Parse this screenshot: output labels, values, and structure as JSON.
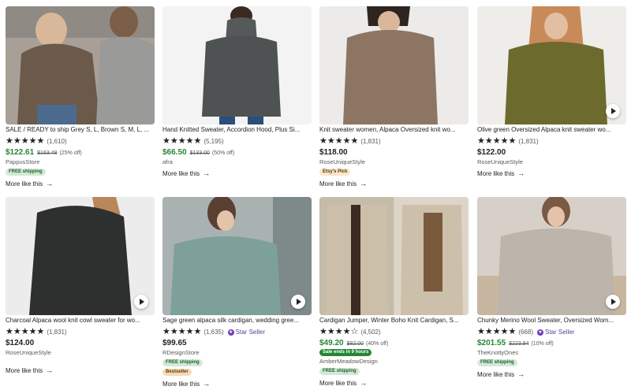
{
  "listings": [
    {
      "title": "SALE / READY to ship Grey S, L, Brown S, M, L, ...",
      "stars": "★★★★★",
      "rating_count": "(1,610)",
      "price": "$122.61",
      "original_price": "$163.48",
      "discount": "(25% off)",
      "shop": "PappusStore",
      "tags": [
        "FREE shipping"
      ],
      "more": "More like this",
      "colors": {
        "bg": "#c9c2b8",
        "fg": "#6b5a4a"
      }
    },
    {
      "title": "Hand Knitted Sweater, Accordion Hood, Plus Si...",
      "stars": "★★★★★",
      "rating_count": "(5,195)",
      "price": "$66.50",
      "original_price": "$133.00",
      "discount": "(50% off)",
      "shop": "afra",
      "tags": [],
      "more": "More like this",
      "colors": {
        "bg": "#f2f2f2",
        "fg": "#4f5253"
      }
    },
    {
      "title": "Knit sweater women, Alpaca Oversized knit wo...",
      "stars": "★★★★★",
      "rating_count": "(1,831)",
      "price": "$118.00",
      "original_price": "",
      "discount": "",
      "shop": "RoseUniqueStyle",
      "tags": [
        "Etsy's Pick"
      ],
      "more": "More like this",
      "colors": {
        "bg": "#e9e7e5",
        "fg": "#8c7663"
      }
    },
    {
      "title": "Olive green Oversized Alpaca knit sweater wo...",
      "stars": "★★★★★",
      "rating_count": "(1,831)",
      "price": "$122.00",
      "original_price": "",
      "discount": "",
      "shop": "RoseUniqueStyle",
      "tags": [],
      "more": "More like this",
      "colors": {
        "bg": "#efede9",
        "fg": "#6d6a2e"
      }
    },
    {
      "title": "Charcoal Alpaca wool knit cowl sweater for wo...",
      "stars": "★★★★★",
      "rating_count": "(1,831)",
      "price": "$124.00",
      "original_price": "",
      "discount": "",
      "shop": "RoseUniqueStyle",
      "tags": [],
      "more": "More like this",
      "colors": {
        "bg": "#ebebeb",
        "fg": "#2e3030"
      }
    },
    {
      "title": "Sage green alpaca silk cardigan, wedding gree...",
      "stars": "★★★★★",
      "rating_count": "(1,635)",
      "star_seller": "Star Seller",
      "price": "$99.65",
      "original_price": "",
      "discount": "",
      "shop": "RDesignStore",
      "tags": [
        "FREE shipping",
        "Bestseller"
      ],
      "more": "More like this",
      "colors": {
        "bg": "#aeb7b5",
        "fg": "#7da09a"
      }
    },
    {
      "title": "Cardigan Jumper, Winter Boho Knit Cardigan, S...",
      "stars": "★★★★☆",
      "rating_count": "(4,502)",
      "price": "$49.20",
      "original_price": "$82.00",
      "discount": "(40% off)",
      "shop": "AmberMeadowDesign",
      "tags": [
        "Sale ends in 9 hours",
        "FREE shipping"
      ],
      "more": "More like this",
      "colors": {
        "bg": "#d8d0c4",
        "fg": "#cbbfa9"
      }
    },
    {
      "title": "Chunky Merino Wool Sweater, Oversized Wom...",
      "stars": "★★★★★",
      "rating_count": "(668)",
      "star_seller": "Star Seller",
      "price": "$201.55",
      "original_price": "$223.94",
      "discount": "(10% off)",
      "shop": "TheKnottyOnes",
      "tags": [
        "FREE shipping"
      ],
      "more": "More like this",
      "colors": {
        "bg": "#d9d3cb",
        "fg": "#bdb5ab"
      }
    }
  ]
}
